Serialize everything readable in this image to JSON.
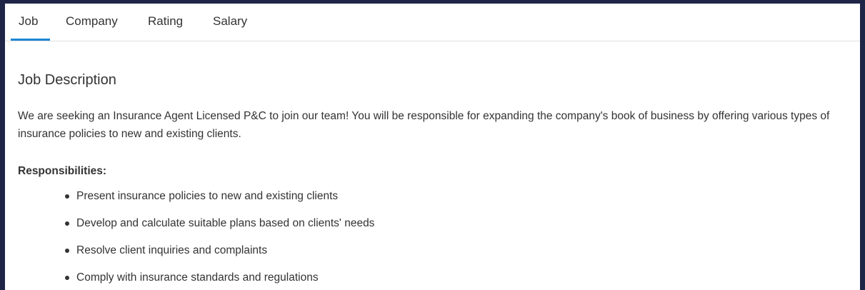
{
  "tabs": [
    {
      "label": "Job",
      "active": true
    },
    {
      "label": "Company",
      "active": false
    },
    {
      "label": "Rating",
      "active": false
    },
    {
      "label": "Salary",
      "active": false
    }
  ],
  "job": {
    "section_title": "Job Description",
    "description": "We are seeking an Insurance Agent Licensed P&C to join our team! You will be responsible for expanding the company's book of business by offering various types of insurance policies to new and existing clients.",
    "responsibilities_heading": "Responsibilities:",
    "responsibilities": [
      "Present insurance policies to new and existing clients",
      "Develop and calculate suitable plans based on clients' needs",
      "Resolve client inquiries and complaints",
      "Comply with insurance standards and regulations"
    ]
  },
  "colors": {
    "accent": "#1e87d4",
    "text": "#333333",
    "outer_background": "#1f2547"
  }
}
